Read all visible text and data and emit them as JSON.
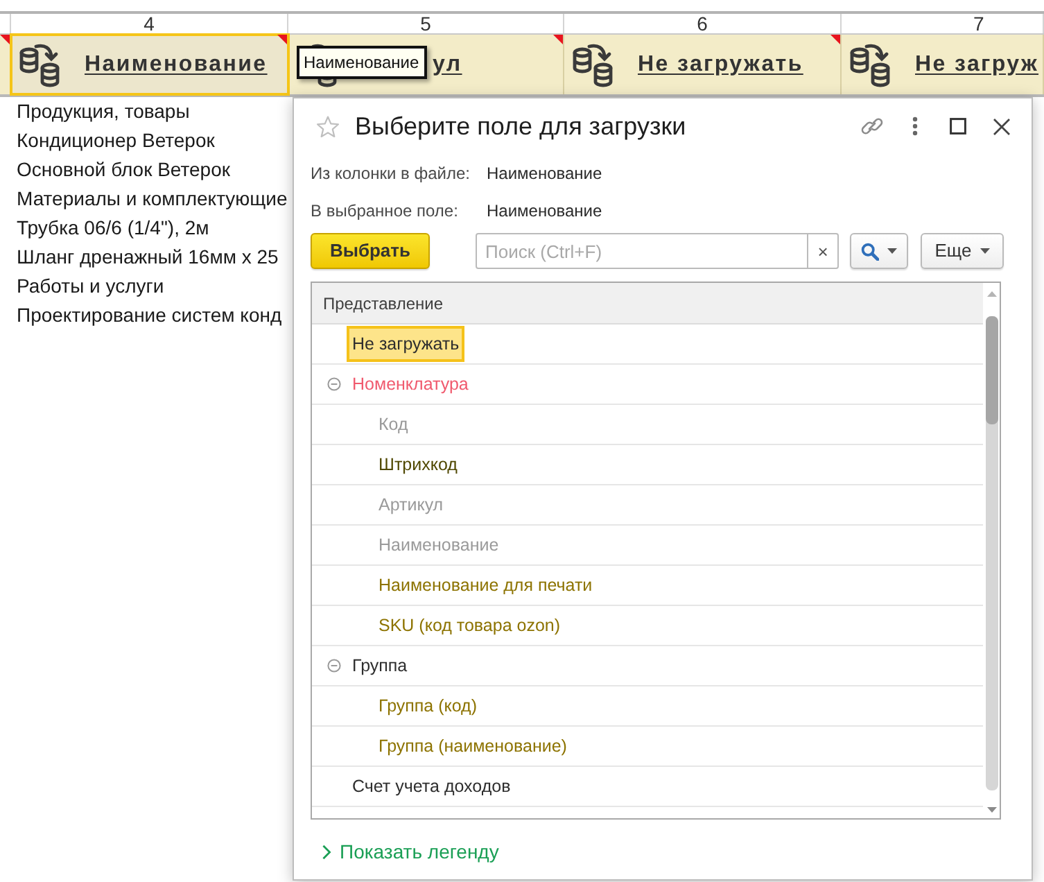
{
  "sheet": {
    "columns": [
      {
        "selected": false,
        "marked": true
      },
      {
        "number": "4",
        "label": "Наименование",
        "selected": true,
        "marked": true
      },
      {
        "number": "5",
        "label": "ул",
        "selected": false,
        "marked": true,
        "tooltip": "Наименование"
      },
      {
        "number": "6",
        "label": "Не загружать",
        "selected": false,
        "marked": true
      },
      {
        "number": "7",
        "label": "Не загруж",
        "selected": false,
        "marked": false
      }
    ],
    "rows": [
      "Продукция, товары",
      "Кондиционер Ветерок",
      "Основной блок Ветерок",
      "Материалы и комплектующие",
      "Трубка 06/6 (1/4\"), 2м",
      "Шланг дренажный 16мм х 25",
      "Работы и услуги",
      "Проектирование систем конд"
    ]
  },
  "dialog": {
    "title": "Выберите поле для загрузки",
    "fields": [
      {
        "label": "Из колонки в файле:",
        "value": "Наименование"
      },
      {
        "label": "В выбранное поле:",
        "value": "Наименование"
      }
    ],
    "toolbar": {
      "select_button": "Выбрать",
      "search": {
        "placeholder": "Поиск (Ctrl+F)"
      },
      "clear_button": "×",
      "more_button": "Еще"
    },
    "table": {
      "column": "Представление",
      "items": [
        {
          "label": "Не загружать",
          "selected": true
        },
        {
          "label": "Номенклатура",
          "color": "#f05a6e",
          "selected": false,
          "expanded": true,
          "children": [
            {
              "label": "Код",
              "color": "#9a9a9a",
              "selected": false
            },
            {
              "label": "Штрихкод",
              "color": "#504800",
              "selected": false
            },
            {
              "label": "Артикул",
              "color": "#9a9a9a",
              "selected": false
            },
            {
              "label": "Наименование",
              "color": "#9a9a9a",
              "selected": false
            },
            {
              "label": "Наименование для печати",
              "color": "#8d7300",
              "selected": false
            },
            {
              "label": "SKU (код товара ozon)",
              "color": "#8d7300",
              "selected": false
            }
          ]
        },
        {
          "label": "Группа",
          "selected": false,
          "expanded": true,
          "children": [
            {
              "label": "Группа (код)",
              "color": "#8d7300",
              "selected": false
            },
            {
              "label": "Группа (наименование)",
              "color": "#8d7300",
              "selected": false
            }
          ]
        },
        {
          "label": "Счет учета доходов",
          "selected": false
        }
      ]
    },
    "legend_link": "Показать легенду"
  }
}
